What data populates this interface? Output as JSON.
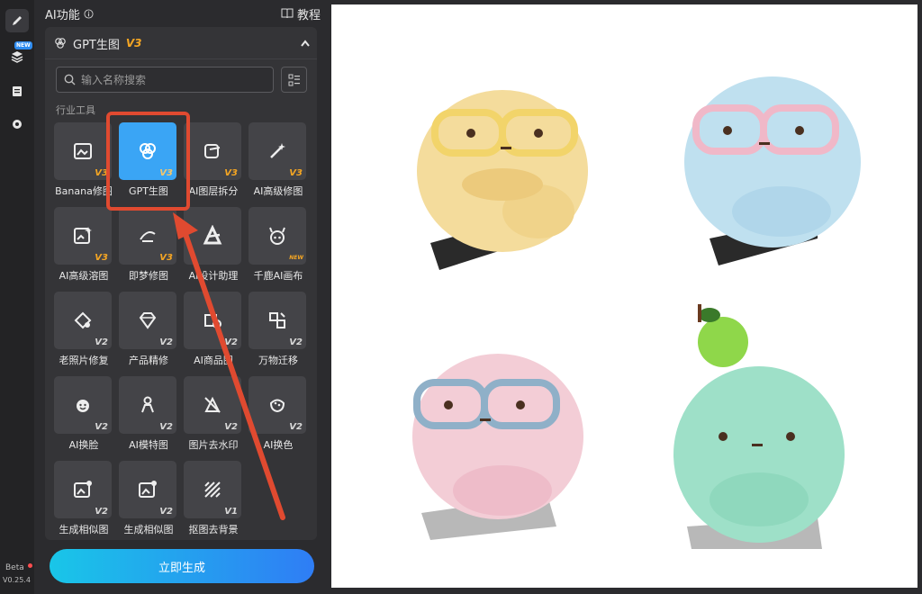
{
  "topbar": {
    "title": "AI功能",
    "tutorial": "教程"
  },
  "rail": {
    "new_badge": "NEW",
    "beta": "Beta",
    "version": "V0.25.4"
  },
  "card": {
    "title": "GPT生图",
    "version_tag": "V3"
  },
  "search": {
    "placeholder": "输入名称搜索"
  },
  "section": {
    "label": "行业工具"
  },
  "tools": [
    {
      "name": "Banana修图",
      "ver": "V3",
      "icon": "image-edit-icon"
    },
    {
      "name": "GPT生图",
      "ver": "V3",
      "icon": "gpt-knot-icon",
      "selected": true
    },
    {
      "name": "AI图层拆分",
      "ver": "V3",
      "icon": "layer-split-icon"
    },
    {
      "name": "AI高级修图",
      "ver": "V3",
      "icon": "magic-wand-icon"
    },
    {
      "name": "AI高级溶图",
      "ver": "V3",
      "icon": "image-sparkle-icon"
    },
    {
      "name": "即梦修图",
      "ver": "V3",
      "icon": "jimeng-icon"
    },
    {
      "name": "AI设计助理",
      "ver": "",
      "icon": "design-assistant-icon"
    },
    {
      "name": "千鹿AI画布",
      "ver": "NEW",
      "icon": "deer-icon"
    },
    {
      "name": "老照片修复",
      "ver": "V2",
      "icon": "photo-repair-icon"
    },
    {
      "name": "产品精修",
      "ver": "V2",
      "icon": "diamond-icon"
    },
    {
      "name": "AI商品图",
      "ver": "V2",
      "icon": "product-icon"
    },
    {
      "name": "万物迁移",
      "ver": "V2",
      "icon": "transfer-icon"
    },
    {
      "name": "AI换脸",
      "ver": "V2",
      "icon": "face-swap-icon"
    },
    {
      "name": "AI模特图",
      "ver": "V2",
      "icon": "model-icon"
    },
    {
      "name": "图片去水印",
      "ver": "V2",
      "icon": "remove-watermark-icon"
    },
    {
      "name": "AI换色",
      "ver": "V2",
      "icon": "palette-icon"
    },
    {
      "name": "生成相似图",
      "ver": "V2",
      "icon": "similar-image-icon"
    },
    {
      "name": "生成相似图",
      "ver": "V2",
      "icon": "similar-image-icon"
    },
    {
      "name": "抠图去背景",
      "ver": "V1",
      "icon": "cutout-icon"
    }
  ],
  "generate": {
    "label": "立即生成"
  },
  "colors": {
    "accent": "#3aa5f5",
    "highlight": "#e04a30",
    "version_gold": "#f5a623"
  }
}
